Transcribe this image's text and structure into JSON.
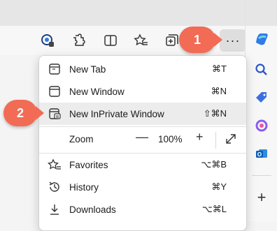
{
  "menu": {
    "items": [
      {
        "label": "New Tab",
        "shortcut": "⌘T",
        "icon": "new-tab-icon"
      },
      {
        "label": "New Window",
        "shortcut": "⌘N",
        "icon": "new-window-icon"
      },
      {
        "label": "New InPrivate Window",
        "shortcut": "⇧⌘N",
        "icon": "inprivate-window-icon"
      }
    ],
    "zoom": {
      "label": "Zoom",
      "minus": "—",
      "value": "100%",
      "plus": "+"
    },
    "items2": [
      {
        "label": "Favorites",
        "shortcut": "⌥⌘B",
        "icon": "favorites-icon"
      },
      {
        "label": "History",
        "shortcut": "⌘Y",
        "icon": "history-icon"
      },
      {
        "label": "Downloads",
        "shortcut": "⌥⌘L",
        "icon": "downloads-icon"
      }
    ]
  },
  "toolbar": {
    "more_label": "···",
    "icons": [
      "tracking-prevention-icon",
      "extensions-icon",
      "split-screen-icon",
      "favorites-star-icon",
      "collections-icon"
    ]
  },
  "sidebar": {
    "icons": [
      "copilot-icon",
      "search-icon",
      "shopping-tag-icon",
      "office-icon",
      "outlook-icon",
      "add-icon"
    ],
    "add_label": "+"
  },
  "badges": {
    "one": "1",
    "two": "2"
  },
  "colors": {
    "badge": "#f26b55",
    "highlight": "#ececec",
    "accent": "#2f7be8"
  }
}
